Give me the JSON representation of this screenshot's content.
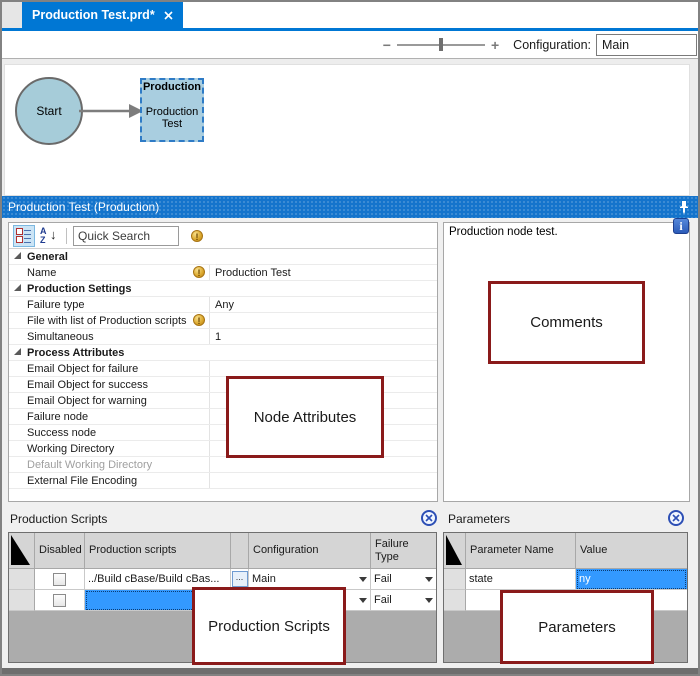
{
  "tab": {
    "title": "Production Test.prd*"
  },
  "toolbar": {
    "zoom_out_label": "−",
    "zoom_in_label": "+",
    "configuration_label": "Configuration:",
    "configuration_value": "Main"
  },
  "canvas": {
    "start_label": "Start",
    "node_type_label": "Production",
    "node_name": "Production Test"
  },
  "titlebar": {
    "title": "Production Test (Production)"
  },
  "icons": {
    "warning_glyph": "!",
    "info_glyph": "i",
    "sort_a": "A",
    "sort_z": "Z",
    "sort_arrow": "↓"
  },
  "property_panel": {
    "quick_search_placeholder": "Quick Search",
    "rows": [
      {
        "kind": "section",
        "label": "General",
        "value": ""
      },
      {
        "kind": "row",
        "label": "Name",
        "value": "Production Test",
        "warning": true
      },
      {
        "kind": "section",
        "label": "Production Settings",
        "value": ""
      },
      {
        "kind": "row",
        "label": "Failure type",
        "value": "Any"
      },
      {
        "kind": "row",
        "label": "File with list of Production scripts",
        "value": "",
        "warning": true
      },
      {
        "kind": "row",
        "label": "Simultaneous",
        "value": "1"
      },
      {
        "kind": "section",
        "label": "Process Attributes",
        "value": ""
      },
      {
        "kind": "row",
        "label": "Email Object for failure",
        "value": ""
      },
      {
        "kind": "row",
        "label": "Email Object for success",
        "value": ""
      },
      {
        "kind": "row",
        "label": "Email Object for warning",
        "value": ""
      },
      {
        "kind": "row",
        "label": "Failure node",
        "value": ""
      },
      {
        "kind": "row",
        "label": "Success node",
        "value": ""
      },
      {
        "kind": "row",
        "label": "Working Directory",
        "value": ""
      },
      {
        "kind": "row",
        "label": "Default Working Directory",
        "value": "",
        "muted": true
      },
      {
        "kind": "row",
        "label": "External File Encoding",
        "value": ""
      }
    ]
  },
  "comments_panel": {
    "text": "Production node test."
  },
  "scripts_section": {
    "title": "Production Scripts",
    "columns": {
      "disabled": "Disabled",
      "scripts": "Production scripts",
      "browse": "",
      "configuration": "Configuration",
      "failure_type": "Failure Type"
    },
    "rows": [
      {
        "script": "../Build cBase/Build cBas...",
        "browse_label": "...",
        "configuration": "Main",
        "failure_type": "Fail"
      },
      {
        "script": "",
        "browse_label": "",
        "configuration": "",
        "failure_type": "Fail"
      }
    ]
  },
  "parameters_section": {
    "title": "Parameters",
    "columns": {
      "name": "Parameter Name",
      "value": "Value"
    },
    "rows": [
      {
        "name": "state",
        "value": "ny"
      },
      {
        "name": "",
        "value": ""
      }
    ]
  },
  "annotations": {
    "node_attributes": "Node Attributes",
    "comments": "Comments",
    "production_scripts": "Production Scripts",
    "parameters": "Parameters"
  },
  "colors": {
    "tab_blue": "#0077d4",
    "titlebar_blue": "#1474cc",
    "selection_blue": "#3399ff",
    "annotation_red": "#8a1a1a"
  }
}
